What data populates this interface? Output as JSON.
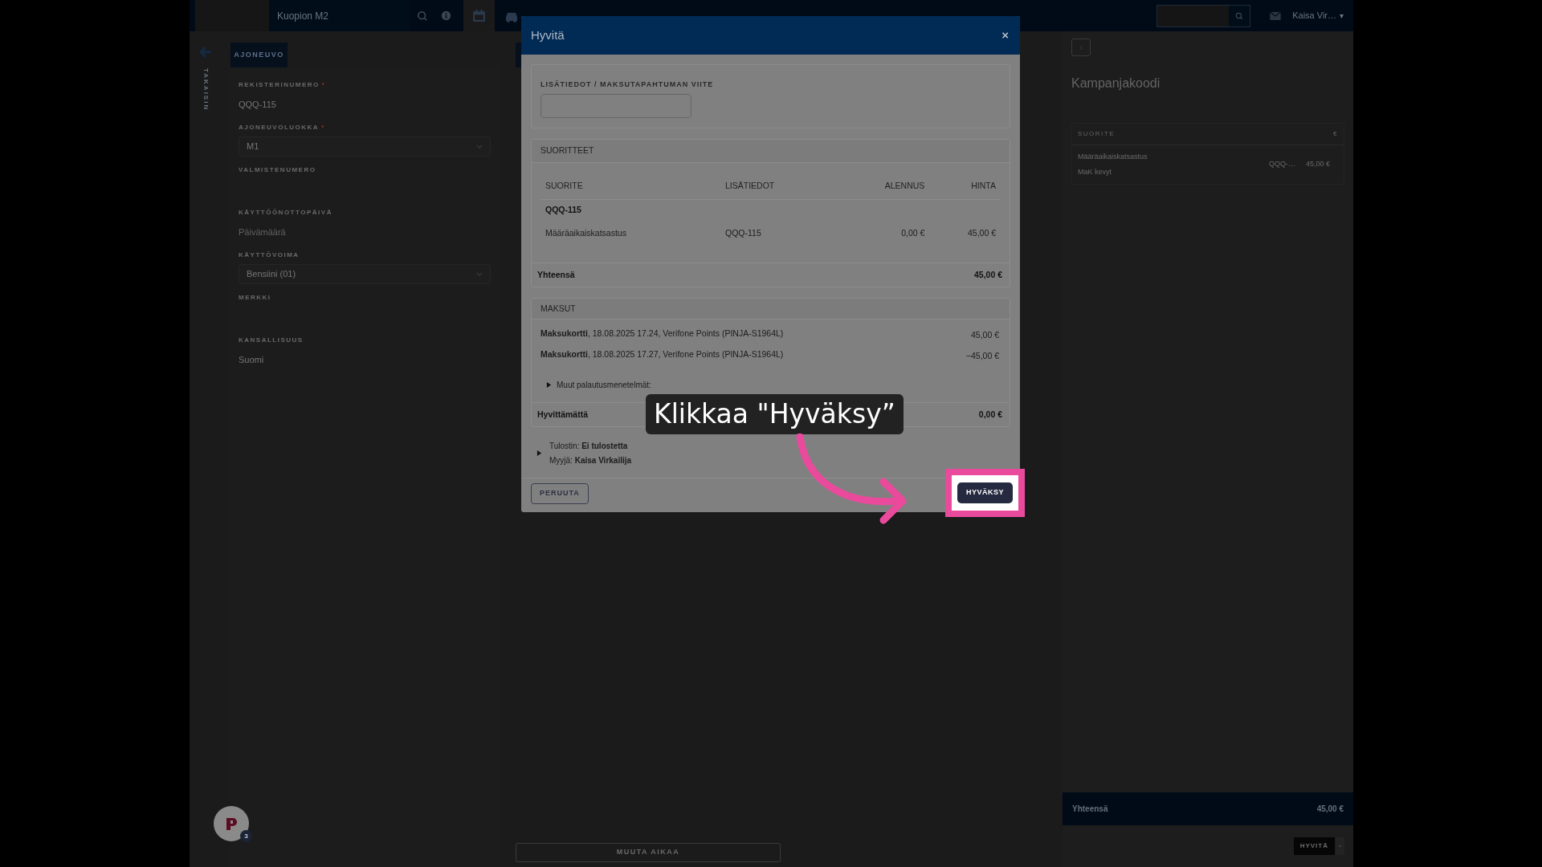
{
  "top_bar": {
    "location": "Kuopion M2",
    "user": "Kaisa Vir…",
    "user_caret": "▾"
  },
  "back": {
    "label": "TAKAISIN"
  },
  "vehicle_panel": {
    "tab": "AJONEUVO",
    "fields": [
      {
        "kind": "text",
        "label": "REKISTERINUMERO",
        "required_mark": "*",
        "value": "QQQ-115"
      },
      {
        "kind": "select",
        "label": "AJONEUVOLUOKKA",
        "required_mark": "*",
        "value": "M1"
      },
      {
        "kind": "text",
        "label": "VALMISTENUMERO"
      },
      {
        "kind": "text",
        "label": "KÄYTTÖÖNOTTOPÄIVÄ",
        "placeholder": "Päivämäärä"
      },
      {
        "kind": "select",
        "label": "KÄYTTÖVOIMA",
        "value": "Bensiini (01)"
      },
      {
        "kind": "text",
        "label": "MERKKI"
      },
      {
        "kind": "text",
        "label": "KANSALLISUUS",
        "value": "Suomi"
      }
    ]
  },
  "schedule_panel": {
    "button": "MUUTA AIKAA"
  },
  "cart_panel": {
    "title": "Kampanjakoodi",
    "columns": [
      "SUORITE",
      "€"
    ],
    "rows": [
      {
        "name": "Määräaikaiskatsastus",
        "detail": "MaK kevyt",
        "ref": "QQQ-…",
        "price": "45,00 €"
      }
    ],
    "total_label": "Yhteensä",
    "total": "45,00 €",
    "button": "HYVITÄ"
  },
  "help_widget": {
    "badge": "3"
  },
  "dialog": {
    "title": "Hyvitä",
    "close": "×",
    "reference_field": {
      "label": "LISÄTIEDOT / MAKSUTAPAHTUMAN VIITE"
    },
    "services": {
      "header": "SUORITTEET",
      "columns": [
        "SUORITE",
        "LISÄTIEDOT",
        "ALENNUS",
        "HINTA"
      ],
      "groups": [
        {
          "title": "QQQ-115",
          "rows": [
            {
              "cells": [
                "Määräaikaiskatsastus",
                "QQQ-115",
                "0,00 €",
                "45,00 €"
              ]
            }
          ]
        }
      ],
      "total_label": "Yhteensä",
      "total": "45,00 €"
    },
    "payments": {
      "header": "MAKSUT",
      "rows": [
        {
          "text": "**Maksukortti**, 18.08.2025 17.24, Verifone Points (PINJA-S1964L)",
          "amount": "45,00 €"
        },
        {
          "text": "**Maksukortti**, 18.08.2025 17.27, Verifone Points (PINJA-S1964L)",
          "amount": "−45,00 €"
        }
      ],
      "other_methods": {
        "label": "Muut palautusmenetelmät:",
        "expanded": false
      },
      "remaining_label": "Hyvittämättä",
      "remaining": "0,00 €"
    },
    "info": {
      "expanded": false,
      "lines": [
        "Tulostin: **Ei tulostetta**",
        "Myyjä: **Kaisa Virkailija**"
      ]
    },
    "buttons": [
      {
        "kind": "secondary",
        "label": "PERUUTA",
        "highlighted": false
      },
      {
        "kind": "primary",
        "label": "HYVÄKSY",
        "highlighted": true
      }
    ]
  },
  "tooltip": {
    "text": "Klikkaa \"Hyväksy”"
  }
}
